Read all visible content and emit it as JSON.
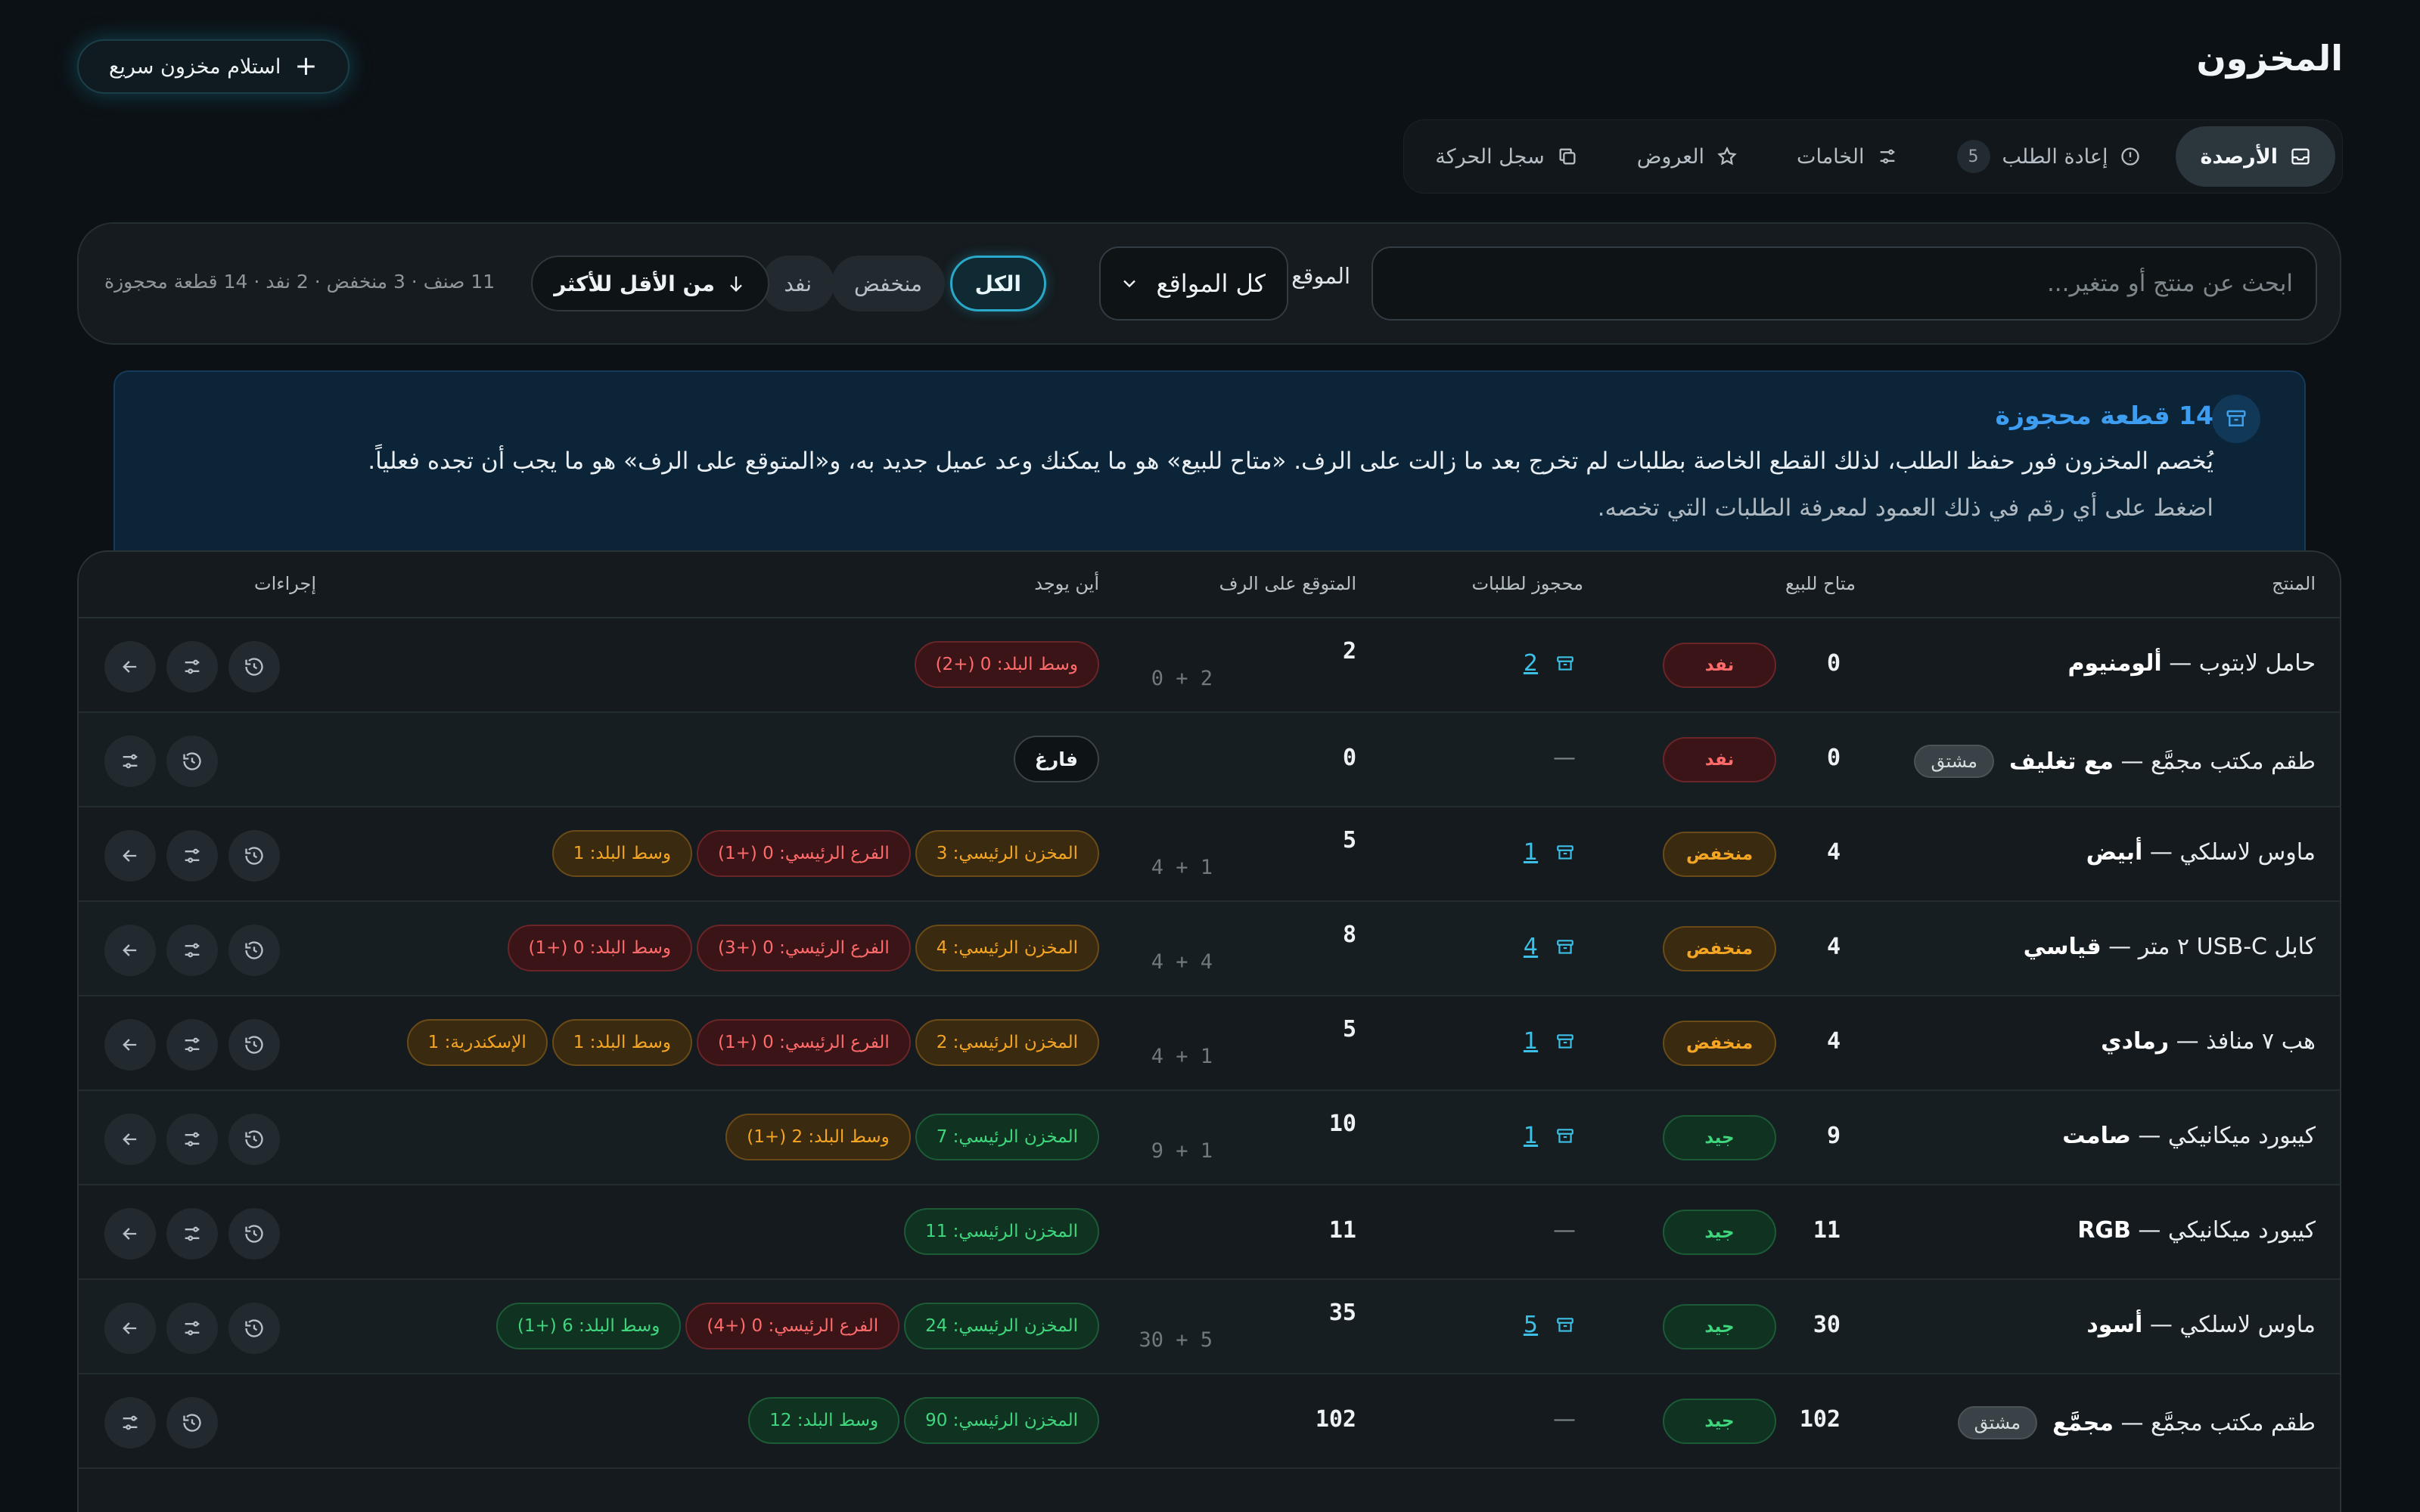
{
  "header": {
    "title": "المخزون",
    "quick_receive_label": "استلام مخزون سريع"
  },
  "tabs": [
    {
      "label": "الأرصدة",
      "icon": "inbox-icon",
      "active": true
    },
    {
      "label": "إعادة الطلب",
      "icon": "alert-circle-icon",
      "count": "5"
    },
    {
      "label": "الخامات",
      "icon": "sliders-icon"
    },
    {
      "label": "العروض",
      "icon": "star-icon"
    },
    {
      "label": "سجل الحركة",
      "icon": "copy-icon"
    }
  ],
  "filters": {
    "search_placeholder": "ابحث عن منتج أو متغير...",
    "location_label": "الموقع",
    "location_value": "كل المواقع",
    "chips": [
      "الكل",
      "منخفض",
      "نفد"
    ],
    "sort_label": "من الأقل للأكثر",
    "summary": "11 صنف · 3 منخفض · 2 نفد · 14 قطعة محجوزة"
  },
  "banner": {
    "title": "14 قطعة محجوزة",
    "text": "يُخصم المخزون فور حفظ الطلب، لذلك القطع الخاصة بطلبات لم تخرج بعد ما زالت على الرف. «متاح للبيع» هو ما يمكنك وعد عميل جديد به، و«المتوقع على الرف» هو ما يجب أن تجده فعلياً.",
    "hint": "اضغط على أي رقم في ذلك العمود لمعرفة الطلبات التي تخصه."
  },
  "table": {
    "headers": {
      "product": "المنتج",
      "available": "متاح  للبيع",
      "reserved": "محجوز  لطلبات",
      "shelf": "المتوقع  على  الرف",
      "where": "أين يوجد",
      "actions": "إجراءات"
    },
    "dash": "—",
    "rows": [
      {
        "name": "حامل لابتوب — ",
        "variant": "ألومنيوم",
        "available": "0",
        "status": "نفد",
        "status_kind": "out",
        "reserved": "2",
        "shelf": "2",
        "shelf_split": "0 + 2",
        "locations": [
          {
            "text": "وسط البلد: 0  (+2)",
            "kind": "r"
          }
        ],
        "actions": 3
      },
      {
        "name": "طقم مكتب مجمَّع — ",
        "variant": "مع تغليف",
        "tag": "مشتق",
        "available": "0",
        "status": "نفد",
        "status_kind": "out",
        "reserved": null,
        "shelf": "0",
        "shelf_split": null,
        "locations": [
          {
            "text": "فارغ",
            "kind": "empty"
          }
        ],
        "actions": 2
      },
      {
        "name": "ماوس لاسلكي — ",
        "variant": "أبيض",
        "available": "4",
        "status": "منخفض",
        "status_kind": "low",
        "reserved": "1",
        "shelf": "5",
        "shelf_split": "4 + 1",
        "locations": [
          {
            "text": "المخزن الرئيسي: 3",
            "kind": "o"
          },
          {
            "text": "الفرع الرئيسي: 0  (+1)",
            "kind": "r"
          },
          {
            "text": "وسط البلد: 1",
            "kind": "o"
          }
        ],
        "actions": 3
      },
      {
        "name": "كابل USB-C ٢ متر — ",
        "variant": "قياسي",
        "available": "4",
        "status": "منخفض",
        "status_kind": "low",
        "reserved": "4",
        "shelf": "8",
        "shelf_split": "4 + 4",
        "locations": [
          {
            "text": "المخزن الرئيسي: 4",
            "kind": "o"
          },
          {
            "text": "الفرع الرئيسي: 0  (+3)",
            "kind": "r"
          },
          {
            "text": "وسط البلد: 0  (+1)",
            "kind": "r"
          }
        ],
        "actions": 3
      },
      {
        "name": "هب ٧ منافذ — ",
        "variant": "رمادي",
        "available": "4",
        "status": "منخفض",
        "status_kind": "low",
        "reserved": "1",
        "shelf": "5",
        "shelf_split": "4 + 1",
        "locations": [
          {
            "text": "المخزن الرئيسي: 2",
            "kind": "o"
          },
          {
            "text": "الفرع الرئيسي: 0  (+1)",
            "kind": "r"
          },
          {
            "text": "وسط البلد: 1",
            "kind": "o"
          },
          {
            "text": "الإسكندرية: 1",
            "kind": "o"
          }
        ],
        "actions": 3
      },
      {
        "name": "كيبورد ميكانيكي — ",
        "variant": "صامت",
        "available": "9",
        "status": "جيد",
        "status_kind": "good",
        "reserved": "1",
        "shelf": "10",
        "shelf_split": "9 + 1",
        "locations": [
          {
            "text": "المخزن الرئيسي: 7",
            "kind": "g"
          },
          {
            "text": "وسط البلد: 2  (+1)",
            "kind": "o"
          }
        ],
        "actions": 3
      },
      {
        "name": "كيبورد ميكانيكي — ",
        "variant": "RGB",
        "available": "11",
        "status": "جيد",
        "status_kind": "good",
        "reserved": null,
        "shelf": "11",
        "shelf_split": null,
        "locations": [
          {
            "text": "المخزن الرئيسي: 11",
            "kind": "g"
          }
        ],
        "actions": 3
      },
      {
        "name": "ماوس لاسلكي — ",
        "variant": "أسود",
        "available": "30",
        "status": "جيد",
        "status_kind": "good",
        "reserved": "5",
        "shelf": "35",
        "shelf_split": "30 + 5",
        "locations": [
          {
            "text": "المخزن الرئيسي: 24",
            "kind": "g"
          },
          {
            "text": "الفرع الرئيسي: 0  (+4)",
            "kind": "r"
          },
          {
            "text": "وسط البلد: 6  (+1)",
            "kind": "g"
          }
        ],
        "actions": 3
      },
      {
        "name": "طقم مكتب مجمَّع — ",
        "variant": "مجمَّع",
        "tag": "مشتق",
        "available": "102",
        "status": "جيد",
        "status_kind": "good",
        "reserved": null,
        "shelf": "102",
        "shelf_split": null,
        "locations": [
          {
            "text": "المخزن الرئيسي: 90",
            "kind": "g"
          },
          {
            "text": "وسط البلد: 12",
            "kind": "g"
          }
        ],
        "actions": 2
      }
    ]
  }
}
